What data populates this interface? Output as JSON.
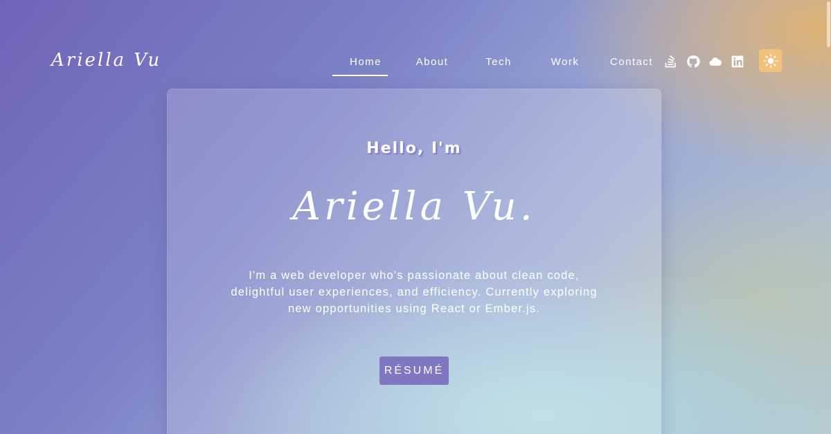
{
  "header": {
    "logo": "Ariella Vu",
    "nav": [
      {
        "label": "Home",
        "active": true
      },
      {
        "label": "About",
        "active": false
      },
      {
        "label": "Tech",
        "active": false
      },
      {
        "label": "Work",
        "active": false
      },
      {
        "label": "Contact",
        "active": false
      }
    ],
    "social_icons": [
      "stackoverflow-icon",
      "github-icon",
      "cloud-icon",
      "linkedin-icon"
    ],
    "theme_toggle_icon": "sun-icon"
  },
  "hero": {
    "greeting": "Hello, I'm",
    "name": "Ariella Vu.",
    "bio": "I'm a web developer who's passionate about clean code, delightful user experiences, and efficiency. Currently exploring new opportunities using React or Ember.js.",
    "button_label": "RÉSUMÉ"
  },
  "colors": {
    "accent_button": "#8176c2",
    "theme_toggle": "#f0c27d",
    "text": "#ffffff"
  }
}
